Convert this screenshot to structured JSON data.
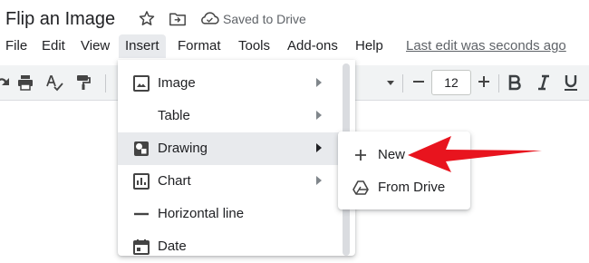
{
  "doc": {
    "title": "Flip an Image",
    "saved_status": "Saved to Drive"
  },
  "menubar": {
    "items": [
      "File",
      "Edit",
      "View",
      "Insert",
      "Format",
      "Tools",
      "Add-ons",
      "Help"
    ],
    "active": "Insert",
    "last_edit": "Last edit was seconds ago"
  },
  "toolbar": {
    "font_size": "12"
  },
  "insert_menu": {
    "items": [
      {
        "label": "Image",
        "icon": "image-icon",
        "has_submenu": true
      },
      {
        "label": "Table",
        "icon": "",
        "has_submenu": true
      },
      {
        "label": "Drawing",
        "icon": "drawing-icon",
        "has_submenu": true,
        "highlighted": true
      },
      {
        "label": "Chart",
        "icon": "chart-icon",
        "has_submenu": true
      },
      {
        "label": "Horizontal line",
        "icon": "horizontal-line-icon",
        "has_submenu": false
      },
      {
        "label": "Date",
        "icon": "date-icon",
        "has_submenu": false
      }
    ]
  },
  "drawing_submenu": {
    "items": [
      {
        "label": "New",
        "icon": "plus-icon"
      },
      {
        "label": "From Drive",
        "icon": "drive-icon"
      }
    ]
  },
  "annotation": {
    "arrow_color": "#e8141e"
  },
  "colors": {
    "menu_hover": "#e8eaed",
    "toolbar_bg": "#f1f3f4",
    "text": "#202124",
    "muted": "#5f6368"
  }
}
